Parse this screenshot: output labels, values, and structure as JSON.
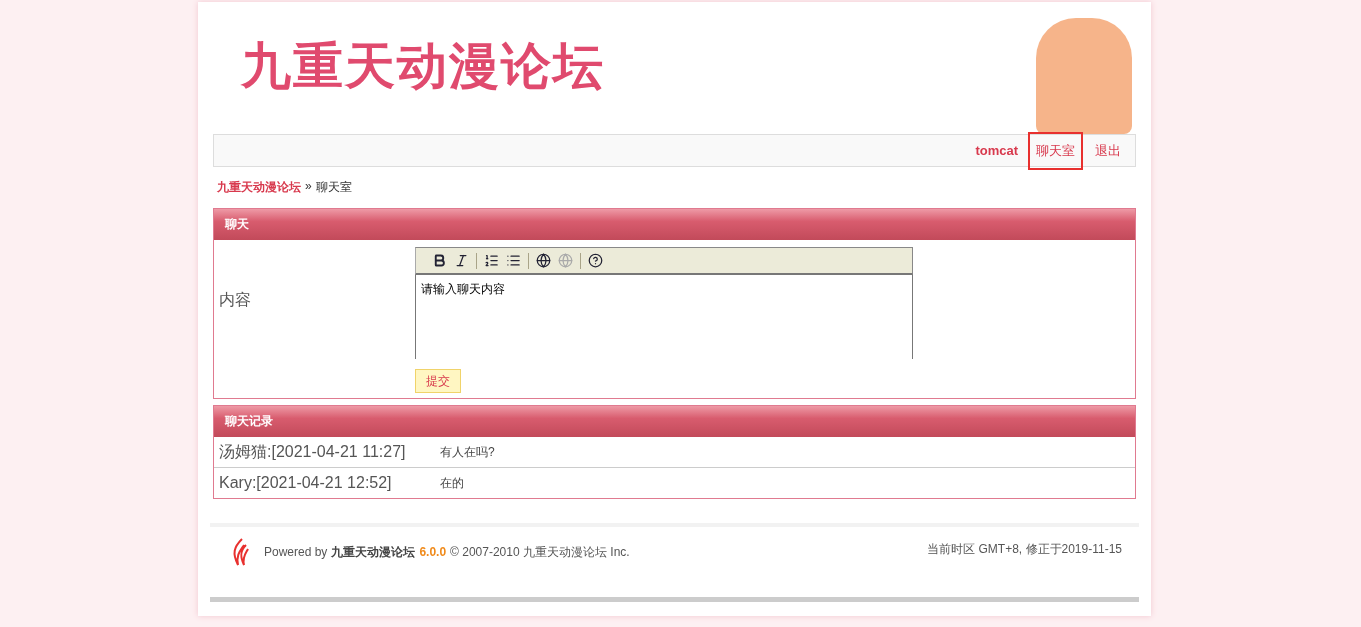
{
  "header": {
    "logo": "九重天动漫论坛"
  },
  "nav": {
    "user": "tomcat",
    "links": [
      {
        "label": "聊天室",
        "selected": true
      },
      {
        "label": "退出",
        "selected": false
      }
    ]
  },
  "breadcrumb": {
    "home": "九重天动漫论坛",
    "separator": "»",
    "current": "聊天室"
  },
  "chat_form": {
    "title": "聊天",
    "label": "内容",
    "toolbar": [
      {
        "kind": "bold",
        "disabled": false
      },
      {
        "kind": "italic",
        "disabled": false
      },
      {
        "kind": "sep"
      },
      {
        "kind": "ordered",
        "disabled": false
      },
      {
        "kind": "bullets",
        "disabled": false
      },
      {
        "kind": "sep"
      },
      {
        "kind": "link",
        "disabled": false
      },
      {
        "kind": "unlink",
        "disabled": true
      },
      {
        "kind": "sep"
      },
      {
        "kind": "help",
        "disabled": false
      }
    ],
    "placeholder": "请输入聊天内容",
    "submit": "提交"
  },
  "history": {
    "title": "聊天记录",
    "rows": [
      {
        "who": "汤姆猫:[2021-04-21 11:27]",
        "message": "有人在吗?"
      },
      {
        "who": "Kary:[2021-04-21 12:52]",
        "message": "在的"
      }
    ]
  },
  "footer": {
    "prefix": "Powered by",
    "site": "九重天动漫论坛",
    "version": "6.0.0",
    "suffix": "© 2007-2010 九重天动漫论坛 Inc.",
    "timezone": "当前时区 GMT+8, 修正于2019-11-15"
  }
}
